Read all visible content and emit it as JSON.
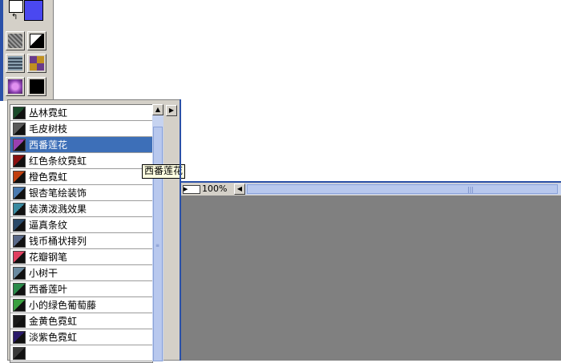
{
  "tools": [
    {
      "name": "tool-texture-gray",
      "color": "#8a8a8a",
      "pattern": "noise"
    },
    {
      "name": "tool-mask",
      "color": "#000000",
      "pattern": "mask"
    },
    {
      "name": "tool-texture-map",
      "color": "#5a6a7a",
      "pattern": "noise"
    },
    {
      "name": "tool-gold-grid",
      "color": "#c09020",
      "pattern": "grid"
    },
    {
      "name": "tool-purple-flower",
      "color": "#b060d0",
      "pattern": "flower"
    },
    {
      "name": "tool-black-strip",
      "color": "#000000",
      "pattern": "strip"
    }
  ],
  "brush_list": {
    "items": [
      {
        "label": "丛林霓虹",
        "thumb": "#1a4a2a",
        "selected": false
      },
      {
        "label": "毛皮树枝",
        "thumb": "#5a5a5a",
        "selected": false
      },
      {
        "label": "西番莲花",
        "thumb": "#9a40b0",
        "selected": true
      },
      {
        "label": "红色条纹霓虹",
        "thumb": "#8a1010",
        "selected": false
      },
      {
        "label": "橙色霓虹",
        "thumb": "#c04010",
        "selected": false
      },
      {
        "label": "银杏笔绘装饰",
        "thumb": "#4a7ab0",
        "selected": false
      },
      {
        "label": "装潢泼溅效果",
        "thumb": "#3a8aa0",
        "selected": false
      },
      {
        "label": "逼真条纹",
        "thumb": "#2a4a6a",
        "selected": false
      },
      {
        "label": "钱币桶状排列",
        "thumb": "#5a6a8a",
        "selected": false
      },
      {
        "label": "花瓣钢笔",
        "thumb": "#e04060",
        "selected": false
      },
      {
        "label": "小树干",
        "thumb": "#6a8aa0",
        "selected": false
      },
      {
        "label": "西番莲叶",
        "thumb": "#2a8a4a",
        "selected": false
      },
      {
        "label": "小的绿色葡萄藤",
        "thumb": "#3aa040",
        "selected": false
      },
      {
        "label": "金黄色霓虹",
        "thumb": "#1a1a1a",
        "selected": false
      },
      {
        "label": "淡紫色霓虹",
        "thumb": "#2a1a6a",
        "selected": false
      },
      {
        "label": "",
        "thumb": "#3a3a3a",
        "selected": false
      }
    ]
  },
  "tooltip": {
    "text": "西番莲花"
  },
  "status": {
    "zoom": "100%"
  },
  "colors": {
    "foreground": "#4a48f0",
    "background": "#ffffff",
    "selection": "#3d6fb8",
    "canvas": "#808080"
  }
}
